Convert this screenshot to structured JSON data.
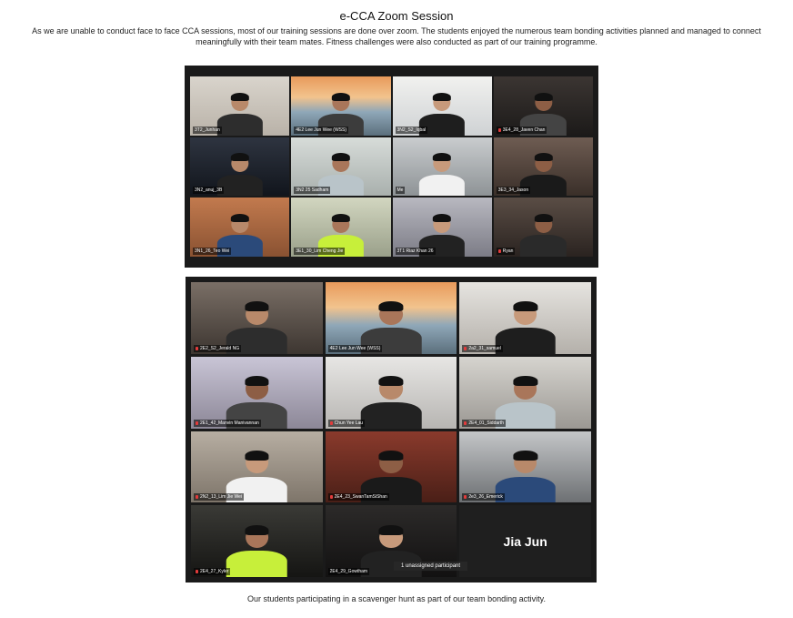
{
  "page": {
    "title": "e-CCA Zoom Session",
    "intro": "As we are unable to conduct face to face CCA sessions, most of our training sessions are done over zoom. The students enjoyed the numerous team bonding activities planned and managed to connect meaningfully with their team mates. Fitness challenges were also conducted as part of our training programme.",
    "caption": "Our students participating in a scavenger hunt as part of our team bonding activity."
  },
  "colors": {
    "active_speaker": "#c8e25a",
    "mic_muted": "#e23b3b",
    "grid_background": "#1a1a1a"
  },
  "gallery1": {
    "participants": [
      {
        "name": "3T2_Junhan",
        "muted": false
      },
      {
        "name": "4E2 Lee Jun Wee (WSS)",
        "muted": false,
        "banner": true
      },
      {
        "name": "3N2_S2_Iqbal",
        "muted": false
      },
      {
        "name": "3E4_28_Javen Chan",
        "muted": true
      },
      {
        "name": "3N2_anuj_3B",
        "muted": false,
        "active": true
      },
      {
        "name": "3N2 25 Sadham",
        "muted": false
      },
      {
        "name": "Me",
        "muted": false
      },
      {
        "name": "3E3_34_Jason",
        "muted": false
      },
      {
        "name": "3N1_26_Teo Wei",
        "muted": false
      },
      {
        "name": "3E1_30_Lim Cheng Jie",
        "muted": false
      },
      {
        "name": "3T1 Riaz Khan 26",
        "muted": false
      },
      {
        "name": "Ryan",
        "muted": true
      }
    ]
  },
  "gallery2": {
    "participants": [
      {
        "name": "2E2_S2_Jerald NG",
        "muted": true
      },
      {
        "name": "4E2 Lee Jun Wee (WSS)",
        "muted": false,
        "banner": true
      },
      {
        "name": "2a2_31_samuel",
        "muted": true
      },
      {
        "name": "2E1_42_Manvin Manivannan",
        "muted": true
      },
      {
        "name": "Chun Yee Lau",
        "muted": true
      },
      {
        "name": "2E4_01_Siddarth",
        "muted": true
      },
      {
        "name": "2N2_13_Lim Jie Wei",
        "muted": true
      },
      {
        "name": "2E4_23_SwanTamSiShan",
        "muted": true
      },
      {
        "name": "2e3_26_Emerick",
        "muted": true
      },
      {
        "name": "2E4_27_Kyler",
        "muted": true
      },
      {
        "name": "2E4_29_Gowtham",
        "muted": false,
        "active": true
      },
      {
        "name": "Jia Jun",
        "muted": false,
        "video_off": true
      }
    ],
    "unassigned_label": "1 unassigned participant"
  }
}
